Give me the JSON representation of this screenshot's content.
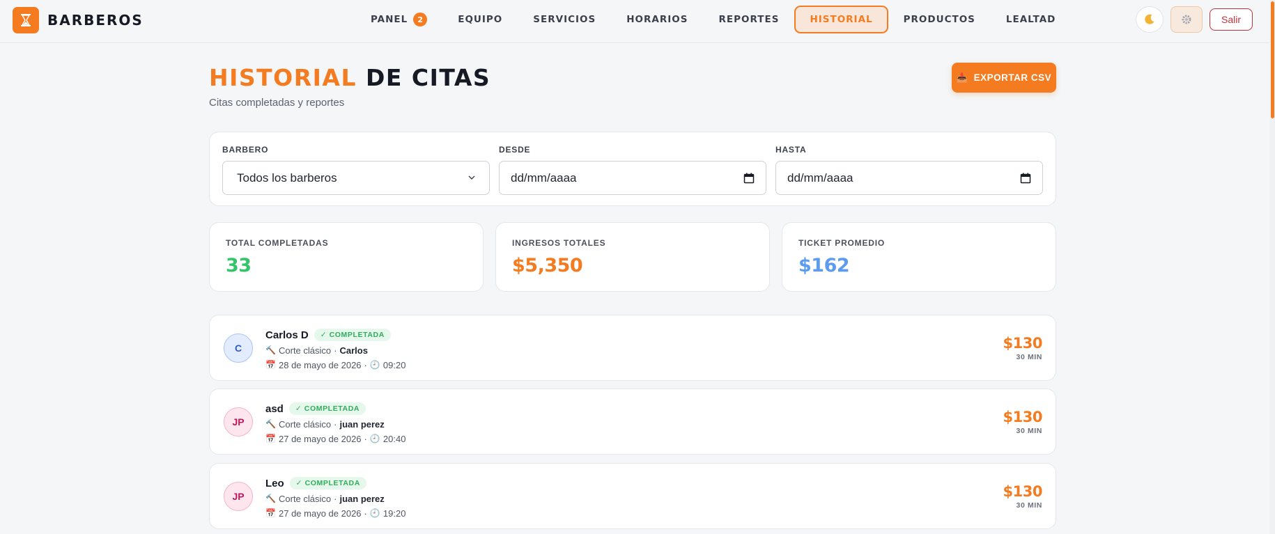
{
  "brand": {
    "name": "BARBEROS"
  },
  "nav": {
    "items": [
      {
        "label": "PANEL",
        "badge": "2"
      },
      {
        "label": "EQUIPO"
      },
      {
        "label": "SERVICIOS"
      },
      {
        "label": "HORARIOS"
      },
      {
        "label": "REPORTES"
      },
      {
        "label": "HISTORIAL",
        "active": true
      },
      {
        "label": "PRODUCTOS"
      },
      {
        "label": "LEALTAD"
      }
    ]
  },
  "actions": {
    "theme_icon": "moon-icon",
    "settings_icon": "gear-icon",
    "logout_label": "Salir"
  },
  "page": {
    "title_accent": "HISTORIAL",
    "title_rest": "DE CITAS",
    "subtitle": "Citas completadas y reportes",
    "export_label": "EXPORTAR CSV"
  },
  "filters": {
    "barber": {
      "label": "BARBERO",
      "value": "Todos los barberos"
    },
    "from": {
      "label": "DESDE",
      "value": "dd/mm/aaaa"
    },
    "to": {
      "label": "HASTA",
      "value": "dd/mm/aaaa"
    }
  },
  "stats": [
    {
      "label": "TOTAL COMPLETADAS",
      "value": "33",
      "color": "#34c46a"
    },
    {
      "label": "INGRESOS TOTALES",
      "value": "$5,350",
      "color": "#f47b20"
    },
    {
      "label": "TICKET PROMEDIO",
      "value": "$162",
      "color": "#5b9cf0"
    }
  ],
  "appointments": [
    {
      "initials": "C",
      "avatar_color": "blue",
      "client": "Carlos D",
      "status": "✓ COMPLETADA",
      "service": "Corte clásico",
      "barber": "Carlos",
      "date": "28 de mayo de 2026",
      "time": "09:20",
      "price": "$130",
      "duration": "30 MIN"
    },
    {
      "initials": "JP",
      "avatar_color": "pink",
      "client": "asd",
      "status": "✓ COMPLETADA",
      "service": "Corte clásico",
      "barber": "juan perez",
      "date": "27 de mayo de 2026",
      "time": "20:40",
      "price": "$130",
      "duration": "30 MIN"
    },
    {
      "initials": "JP",
      "avatar_color": "pink",
      "client": "Leo",
      "status": "✓ COMPLETADA",
      "service": "Corte clásico",
      "barber": "juan perez",
      "date": "27 de mayo de 2026",
      "time": "19:20",
      "price": "$130",
      "duration": "30 MIN"
    }
  ]
}
